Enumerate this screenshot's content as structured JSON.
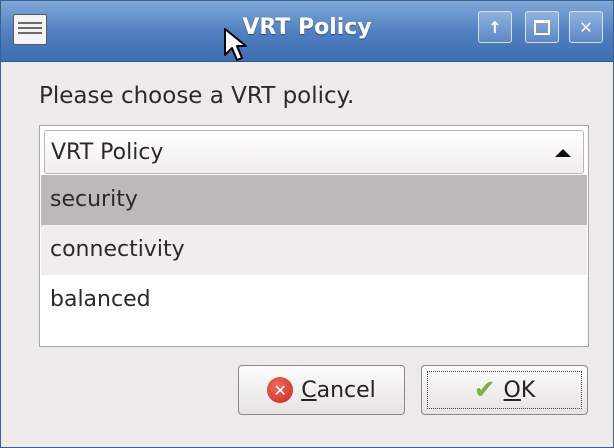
{
  "window": {
    "title": "VRT Policy",
    "titlebar_buttons": {
      "up": "↑",
      "close": "✕"
    }
  },
  "dialog": {
    "prompt": "Please choose a VRT policy."
  },
  "combo": {
    "header_label": "VRT Policy",
    "options": [
      "security",
      "connectivity",
      "balanced"
    ],
    "highlighted_index": 0
  },
  "buttons": {
    "cancel": {
      "mnemonic": "C",
      "rest": "ancel"
    },
    "ok": {
      "mnemonic": "O",
      "rest": "K"
    }
  },
  "colors": {
    "titlebar": "#4f7ec0",
    "highlight": "#bcbab6",
    "ok_check": "#78b13c",
    "cancel_icon": "#c8261b"
  },
  "icons": {
    "window_menu": "window-menu-icon",
    "cancel": "cancel-icon",
    "ok": "checkmark-icon"
  }
}
